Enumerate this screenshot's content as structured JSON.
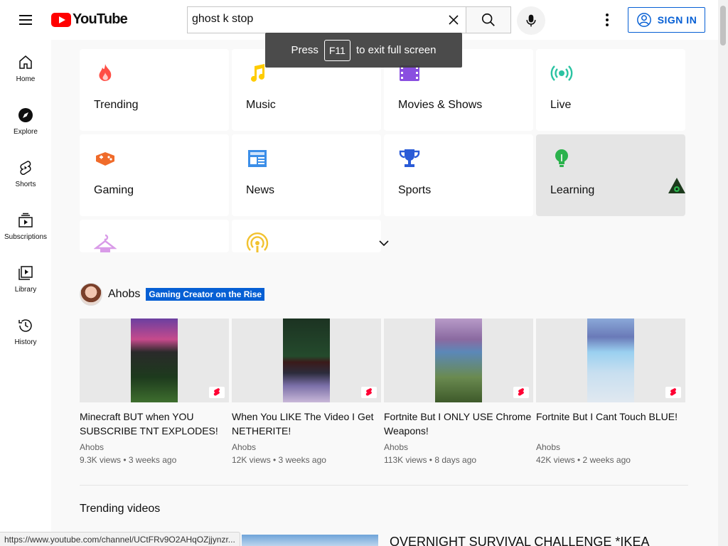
{
  "header": {
    "logo_text": "YouTube",
    "search_value": "ghost k stop",
    "signin_label": "SIGN IN"
  },
  "fullscreen_toast": {
    "press": "Press",
    "key": "F11",
    "rest": "to exit full screen"
  },
  "sidebar": {
    "items": [
      {
        "label": "Home",
        "icon": "home-icon"
      },
      {
        "label": "Explore",
        "icon": "compass-icon"
      },
      {
        "label": "Shorts",
        "icon": "shorts-icon"
      },
      {
        "label": "Subscriptions",
        "icon": "subscriptions-icon"
      },
      {
        "label": "Library",
        "icon": "library-icon"
      },
      {
        "label": "History",
        "icon": "history-icon"
      }
    ]
  },
  "categories": [
    {
      "label": "Trending",
      "icon": "flame-icon",
      "color": "#ff4e45"
    },
    {
      "label": "Music",
      "icon": "music-note-icon",
      "color": "#ffcc00"
    },
    {
      "label": "Movies & Shows",
      "icon": "film-icon",
      "color": "#8a4fe0"
    },
    {
      "label": "Live",
      "icon": "live-icon",
      "color": "#2ac3a2"
    },
    {
      "label": "Gaming",
      "icon": "gamepad-icon",
      "color": "#f06b2a"
    },
    {
      "label": "News",
      "icon": "newspaper-icon",
      "color": "#3b8ee8"
    },
    {
      "label": "Sports",
      "icon": "trophy-icon",
      "color": "#2a5bd7"
    },
    {
      "label": "Learning",
      "icon": "lightbulb-icon",
      "color": "#2bb24c"
    },
    {
      "label": "",
      "icon": "hanger-icon",
      "color": "#d99be8"
    },
    {
      "label": "",
      "icon": "podcast-icon",
      "color": "#f2c230"
    }
  ],
  "channel": {
    "name": "Ahobs",
    "badge": "Gaming Creator on the Rise"
  },
  "videos": [
    {
      "title": "Minecraft BUT when YOU SUBSCRIBE TNT EXPLODES!",
      "channel": "Ahobs",
      "meta": "9.3K views • 3 weeks ago"
    },
    {
      "title": "When You LIKE The Video I Get NETHERITE!",
      "channel": "Ahobs",
      "meta": "12K views • 3 weeks ago"
    },
    {
      "title": "Fortnite But I ONLY USE Chrome Weapons!",
      "channel": "Ahobs",
      "meta": "113K views • 8 days ago"
    },
    {
      "title": "Fortnite But I Cant Touch BLUE!",
      "channel": "Ahobs",
      "meta": "42K views • 2 weeks ago"
    }
  ],
  "trending": {
    "section_title": "Trending videos",
    "first_title": "OVERNIGHT SURVIVAL CHALLENGE *IKEA"
  },
  "status_url": "https://www.youtube.com/channel/UCtFRv9O2AHqOZjjynzr...",
  "colors": {
    "accent": "#065fd4",
    "brand": "#ff0000",
    "shorts": "#ff0033"
  }
}
